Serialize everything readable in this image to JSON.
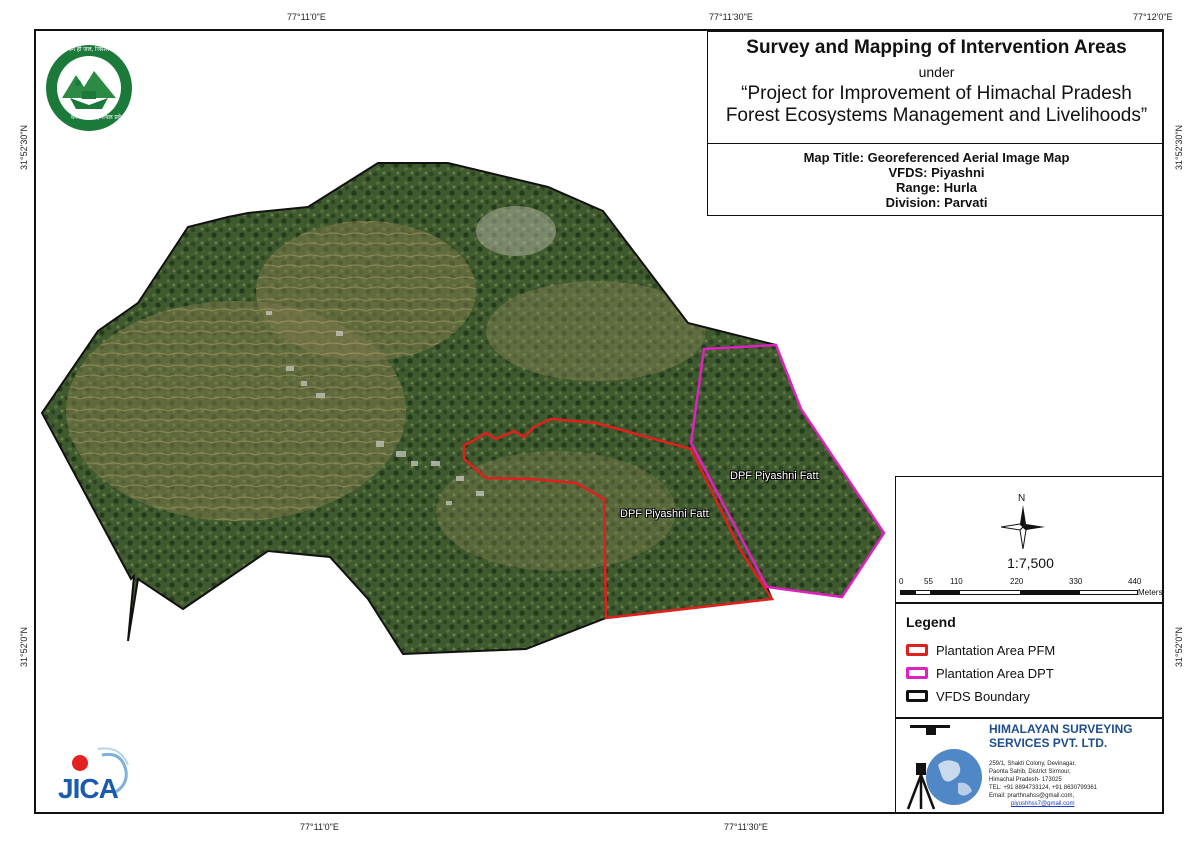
{
  "coordinates": {
    "top": [
      "77°11'0\"E",
      "77°11'30\"E",
      "77°12'0\"E"
    ],
    "bottom": [
      "77°11'0\"E",
      "77°11'30\"E"
    ],
    "left": [
      "31°52'30\"N",
      "31°52'0\"N"
    ],
    "right": [
      "31°52'30\"N",
      "31°52'0\"N"
    ]
  },
  "title": {
    "main": "Survey and Mapping of Intervention Areas",
    "under": "under",
    "project_line1": "“Project for Improvement of Himachal Pradesh",
    "project_line2": "Forest Ecosystems Management and Livelihoods”"
  },
  "map_info": {
    "map_title": "Map Title: Georeferenced Aerial Image Map",
    "vfds": "VFDS: Piyashni",
    "range": "Range: Hurla",
    "division": "Division: Parvati"
  },
  "map_labels": {
    "dpt_label": "DPF Piyashni Fatt",
    "pfm_label": "DPF Piyashni Fatt"
  },
  "scale": {
    "north": "N",
    "ratio": "1:7,500",
    "ticks": [
      "0",
      "55",
      "110",
      "220",
      "330",
      "440"
    ],
    "unit": "Meters"
  },
  "legend": {
    "title": "Legend",
    "items": [
      {
        "label": "Plantation Area PFM",
        "color": "#e0201c"
      },
      {
        "label": "Plantation Area DPT",
        "color": "#e020c0"
      },
      {
        "label": "VFDS Boundary",
        "color": "#111111"
      }
    ]
  },
  "company": {
    "name_line1": "HIMALAYAN SURVEYING",
    "name_line2": "SERVICES PVT. LTD.",
    "address": [
      "259/1, Shakti Colony, Devinagar,",
      "Paonta Sahib, District Sirmour,",
      "Himachal Pradesh- 173025",
      "TEL: +91 8894733124, +91 8630799361",
      "Email: prarthnahss@gmail.com,"
    ],
    "email2": "piyushhss7@gmail.com"
  },
  "emblem": {
    "top_text": "वन ही जल, जिससे कल्याण",
    "bottom_text": "वन विभाग हिमाचल प्रदेश"
  },
  "logo_text": "JICA",
  "colors": {
    "pfm_boundary": "#e0201c",
    "dpt_boundary": "#e020c0",
    "vfds_boundary": "#111111",
    "company_blue": "#1f4e8c",
    "emblem_green": "#1b7a3a"
  }
}
